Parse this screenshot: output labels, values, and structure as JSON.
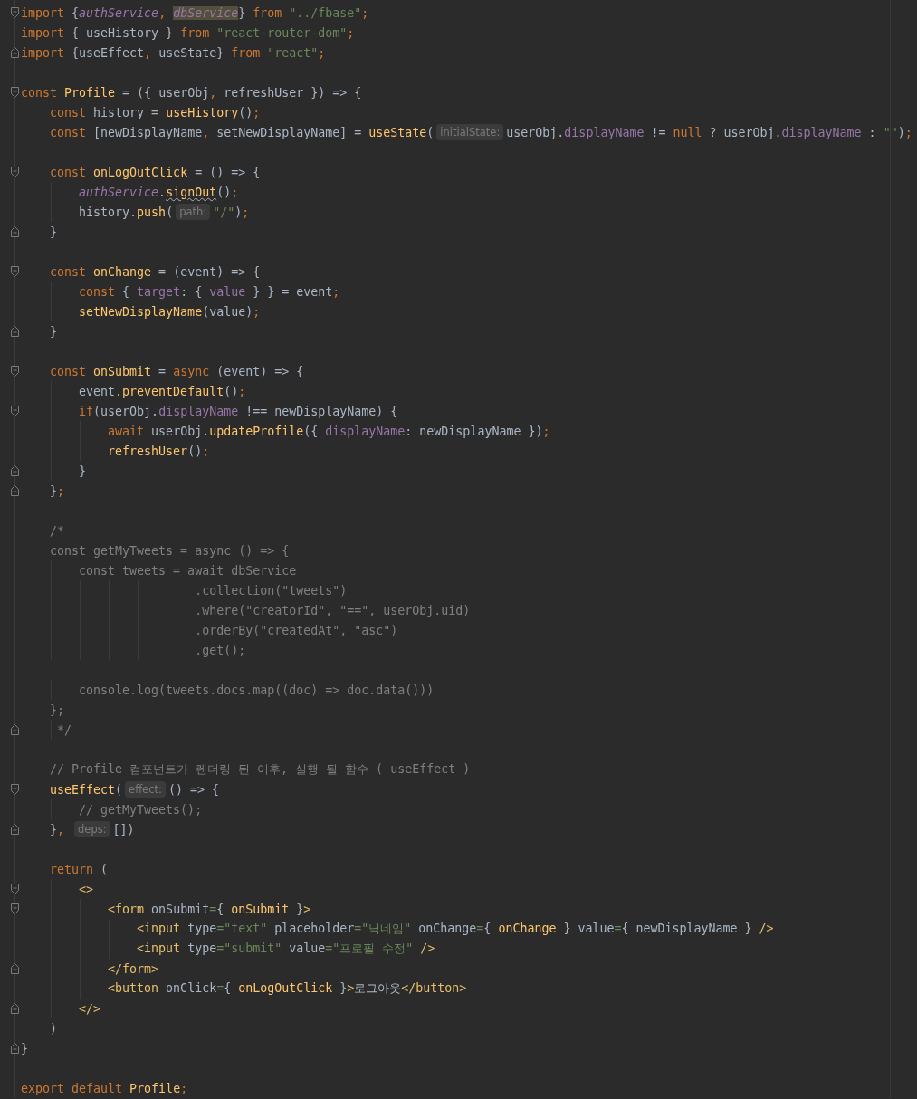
{
  "editor": {
    "lines": [
      {
        "kind": "fold-start",
        "tokens": [
          {
            "kind": "keyword",
            "text": "import "
          },
          {
            "kind": "plain",
            "text": "{"
          },
          {
            "kind": "italic-field",
            "text": "authService"
          },
          {
            "kind": "keyword",
            "text": ", "
          },
          {
            "kind": "highlighted",
            "text": "dbService"
          },
          {
            "kind": "plain",
            "text": "} "
          },
          {
            "kind": "keyword",
            "text": "from "
          },
          {
            "kind": "string",
            "text": "\"../fbase\""
          },
          {
            "kind": "keyword",
            "text": ";"
          }
        ]
      },
      {
        "kind": "code",
        "tokens": [
          {
            "kind": "keyword",
            "text": "import "
          },
          {
            "kind": "plain",
            "text": "{ useHistory } "
          },
          {
            "kind": "keyword",
            "text": "from "
          },
          {
            "kind": "string",
            "text": "\"react-router-dom\""
          },
          {
            "kind": "keyword",
            "text": ";"
          }
        ]
      },
      {
        "kind": "fold-end",
        "tokens": [
          {
            "kind": "keyword",
            "text": "import "
          },
          {
            "kind": "plain",
            "text": "{useEffect"
          },
          {
            "kind": "keyword",
            "text": ", "
          },
          {
            "kind": "plain",
            "text": "useState} "
          },
          {
            "kind": "keyword",
            "text": "from "
          },
          {
            "kind": "string",
            "text": "\"react\""
          },
          {
            "kind": "keyword",
            "text": ";"
          }
        ]
      },
      {
        "kind": "blank"
      },
      {
        "kind": "fold-start",
        "tokens": [
          {
            "kind": "keyword",
            "text": "const "
          },
          {
            "kind": "function",
            "text": "Profile"
          },
          {
            "kind": "plain",
            "text": " = ({ userObj"
          },
          {
            "kind": "keyword",
            "text": ", "
          },
          {
            "kind": "plain",
            "text": "refreshUser }) => {"
          }
        ]
      },
      {
        "kind": "code",
        "tokens": [
          {
            "kind": "keyword",
            "text": "    const "
          },
          {
            "kind": "plain",
            "text": "history = "
          },
          {
            "kind": "function",
            "text": "useHistory"
          },
          {
            "kind": "plain",
            "text": "()"
          },
          {
            "kind": "keyword",
            "text": ";"
          }
        ]
      },
      {
        "kind": "code",
        "tokens": [
          {
            "kind": "keyword",
            "text": "    const "
          },
          {
            "kind": "plain",
            "text": "[newDisplayName"
          },
          {
            "kind": "keyword",
            "text": ", "
          },
          {
            "kind": "plain",
            "text": "setNewDisplayName] = "
          },
          {
            "kind": "function",
            "text": "useState"
          },
          {
            "kind": "plain",
            "text": "("
          },
          {
            "kind": "hint",
            "text": "initialState:"
          },
          {
            "kind": "plain",
            "text": "userObj."
          },
          {
            "kind": "field",
            "text": "displayName"
          },
          {
            "kind": "plain",
            "text": " != "
          },
          {
            "kind": "keyword",
            "text": "null "
          },
          {
            "kind": "plain",
            "text": "? userObj."
          },
          {
            "kind": "field",
            "text": "displayName"
          },
          {
            "kind": "plain",
            "text": " : "
          },
          {
            "kind": "string",
            "text": "\"\""
          },
          {
            "kind": "plain",
            "text": ")"
          },
          {
            "kind": "keyword",
            "text": ";"
          }
        ]
      },
      {
        "kind": "blank"
      },
      {
        "kind": "fold-start",
        "tokens": [
          {
            "kind": "keyword",
            "text": "    const "
          },
          {
            "kind": "function",
            "text": "onLogOutClick"
          },
          {
            "kind": "plain",
            "text": " = () => {"
          }
        ]
      },
      {
        "kind": "code",
        "tokens": [
          {
            "kind": "italic-field",
            "text": "        authService"
          },
          {
            "kind": "plain",
            "text": "."
          },
          {
            "kind": "warning",
            "text": "signOut"
          },
          {
            "kind": "plain",
            "text": "()"
          },
          {
            "kind": "keyword",
            "text": ";"
          }
        ]
      },
      {
        "kind": "code",
        "tokens": [
          {
            "kind": "plain",
            "text": "        history."
          },
          {
            "kind": "function",
            "text": "push"
          },
          {
            "kind": "plain",
            "text": "("
          },
          {
            "kind": "hint",
            "text": "path:"
          },
          {
            "kind": "string",
            "text": "\"/\""
          },
          {
            "kind": "plain",
            "text": ")"
          },
          {
            "kind": "keyword",
            "text": ";"
          }
        ]
      },
      {
        "kind": "fold-end",
        "tokens": [
          {
            "kind": "plain",
            "text": "    }"
          }
        ]
      },
      {
        "kind": "blank"
      },
      {
        "kind": "fold-start",
        "tokens": [
          {
            "kind": "keyword",
            "text": "    const "
          },
          {
            "kind": "function",
            "text": "onChange"
          },
          {
            "kind": "plain",
            "text": " = (event) => {"
          }
        ]
      },
      {
        "kind": "code",
        "tokens": [
          {
            "kind": "keyword",
            "text": "        const "
          },
          {
            "kind": "plain",
            "text": "{ "
          },
          {
            "kind": "field",
            "text": "target"
          },
          {
            "kind": "plain",
            "text": ": { "
          },
          {
            "kind": "field",
            "text": "value"
          },
          {
            "kind": "plain",
            "text": " } } = event"
          },
          {
            "kind": "keyword",
            "text": ";"
          }
        ]
      },
      {
        "kind": "code",
        "tokens": [
          {
            "kind": "function",
            "text": "        setNewDisplayName"
          },
          {
            "kind": "plain",
            "text": "(value)"
          },
          {
            "kind": "keyword",
            "text": ";"
          }
        ]
      },
      {
        "kind": "fold-end",
        "tokens": [
          {
            "kind": "plain",
            "text": "    }"
          }
        ]
      },
      {
        "kind": "blank"
      },
      {
        "kind": "fold-start",
        "tokens": [
          {
            "kind": "keyword",
            "text": "    const "
          },
          {
            "kind": "function",
            "text": "onSubmit"
          },
          {
            "kind": "plain",
            "text": " = "
          },
          {
            "kind": "keyword",
            "text": "async "
          },
          {
            "kind": "plain",
            "text": "(event) => {"
          }
        ]
      },
      {
        "kind": "code",
        "tokens": [
          {
            "kind": "plain",
            "text": "        event."
          },
          {
            "kind": "function",
            "text": "preventDefault"
          },
          {
            "kind": "plain",
            "text": "()"
          },
          {
            "kind": "keyword",
            "text": ";"
          }
        ]
      },
      {
        "kind": "fold-start",
        "tokens": [
          {
            "kind": "keyword",
            "text": "        if"
          },
          {
            "kind": "plain",
            "text": "(userObj."
          },
          {
            "kind": "field",
            "text": "displayName"
          },
          {
            "kind": "plain",
            "text": " !== newDisplayName) {"
          }
        ]
      },
      {
        "kind": "code",
        "tokens": [
          {
            "kind": "keyword",
            "text": "            await "
          },
          {
            "kind": "plain",
            "text": "userObj."
          },
          {
            "kind": "function",
            "text": "updateProfile"
          },
          {
            "kind": "plain",
            "text": "({ "
          },
          {
            "kind": "field",
            "text": "displayName"
          },
          {
            "kind": "plain",
            "text": ": newDisplayName })"
          },
          {
            "kind": "keyword",
            "text": ";"
          }
        ]
      },
      {
        "kind": "code",
        "tokens": [
          {
            "kind": "function",
            "text": "            refreshUser"
          },
          {
            "kind": "plain",
            "text": "()"
          },
          {
            "kind": "keyword",
            "text": ";"
          }
        ]
      },
      {
        "kind": "fold-end",
        "tokens": [
          {
            "kind": "plain",
            "text": "        }"
          }
        ]
      },
      {
        "kind": "fold-end",
        "tokens": [
          {
            "kind": "plain",
            "text": "    }"
          },
          {
            "kind": "keyword",
            "text": ";"
          }
        ]
      },
      {
        "kind": "blank"
      },
      {
        "kind": "code",
        "tokens": [
          {
            "kind": "comment",
            "text": "    /*"
          }
        ]
      },
      {
        "kind": "code",
        "tokens": [
          {
            "kind": "comment",
            "text": "    const getMyTweets = async () => {"
          }
        ]
      },
      {
        "kind": "code",
        "tokens": [
          {
            "kind": "comment",
            "text": "        const tweets = await dbService"
          }
        ]
      },
      {
        "kind": "code",
        "tokens": [
          {
            "kind": "comment",
            "text": "                        .collection(\"tweets\")"
          }
        ]
      },
      {
        "kind": "code",
        "tokens": [
          {
            "kind": "comment",
            "text": "                        .where(\"creatorId\", \"==\", userObj.uid)"
          }
        ]
      },
      {
        "kind": "code",
        "tokens": [
          {
            "kind": "comment",
            "text": "                        .orderBy(\"createdAt\", \"asc\")"
          }
        ]
      },
      {
        "kind": "code",
        "tokens": [
          {
            "kind": "comment",
            "text": "                        .get();"
          }
        ]
      },
      {
        "kind": "blank"
      },
      {
        "kind": "code",
        "tokens": [
          {
            "kind": "comment",
            "text": "        console.log(tweets.docs.map((doc) => doc.data()))"
          }
        ]
      },
      {
        "kind": "code",
        "tokens": [
          {
            "kind": "comment",
            "text": "    };"
          }
        ]
      },
      {
        "kind": "fold-end",
        "tokens": [
          {
            "kind": "comment",
            "text": "     */"
          }
        ]
      },
      {
        "kind": "blank"
      },
      {
        "kind": "code",
        "tokens": [
          {
            "kind": "comment",
            "text": "    // Profile 컴포넌트가 렌더링 된 이후, 실행 될 함수 ( useEffect )"
          }
        ]
      },
      {
        "kind": "fold-start",
        "tokens": [
          {
            "kind": "function",
            "text": "    useEffect"
          },
          {
            "kind": "plain",
            "text": "("
          },
          {
            "kind": "hint",
            "text": "effect:"
          },
          {
            "kind": "plain",
            "text": "() => {"
          }
        ]
      },
      {
        "kind": "code",
        "tokens": [
          {
            "kind": "comment",
            "text": "        // getMyTweets();"
          }
        ]
      },
      {
        "kind": "fold-end",
        "tokens": [
          {
            "kind": "plain",
            "text": "    }"
          },
          {
            "kind": "keyword",
            "text": ", "
          },
          {
            "kind": "hint",
            "text": "deps:"
          },
          {
            "kind": "plain",
            "text": "[])"
          }
        ]
      },
      {
        "kind": "blank"
      },
      {
        "kind": "code",
        "tokens": [
          {
            "kind": "keyword",
            "text": "    return "
          },
          {
            "kind": "plain",
            "text": "("
          }
        ]
      },
      {
        "kind": "fold-start",
        "tokens": [
          {
            "kind": "tag",
            "text": "        <>"
          }
        ]
      },
      {
        "kind": "fold-start",
        "tokens": [
          {
            "kind": "tag",
            "text": "            <form "
          },
          {
            "kind": "plain",
            "text": "onSubmit"
          },
          {
            "kind": "string",
            "text": "="
          },
          {
            "kind": "plain",
            "text": "{ "
          },
          {
            "kind": "function",
            "text": "onSubmit"
          },
          {
            "kind": "plain",
            "text": " }"
          },
          {
            "kind": "tag",
            "text": ">"
          }
        ]
      },
      {
        "kind": "code",
        "tokens": [
          {
            "kind": "tag",
            "text": "                <input "
          },
          {
            "kind": "plain",
            "text": "type"
          },
          {
            "kind": "string",
            "text": "=\"text\" "
          },
          {
            "kind": "plain",
            "text": "placeholder"
          },
          {
            "kind": "string",
            "text": "=\"닉네임\" "
          },
          {
            "kind": "plain",
            "text": "onChange"
          },
          {
            "kind": "string",
            "text": "="
          },
          {
            "kind": "plain",
            "text": "{ "
          },
          {
            "kind": "function",
            "text": "onChange"
          },
          {
            "kind": "plain",
            "text": " } value"
          },
          {
            "kind": "string",
            "text": "="
          },
          {
            "kind": "plain",
            "text": "{ newDisplayName } "
          },
          {
            "kind": "tag",
            "text": "/>"
          }
        ]
      },
      {
        "kind": "code",
        "tokens": [
          {
            "kind": "tag",
            "text": "                <input "
          },
          {
            "kind": "plain",
            "text": "type"
          },
          {
            "kind": "string",
            "text": "=\"submit\" "
          },
          {
            "kind": "plain",
            "text": "value"
          },
          {
            "kind": "string",
            "text": "=\"프로필 수정\" "
          },
          {
            "kind": "tag",
            "text": "/>"
          }
        ]
      },
      {
        "kind": "fold-end",
        "tokens": [
          {
            "kind": "tag",
            "text": "            </form>"
          }
        ]
      },
      {
        "kind": "code",
        "tokens": [
          {
            "kind": "tag",
            "text": "            <button "
          },
          {
            "kind": "plain",
            "text": "onClick"
          },
          {
            "kind": "string",
            "text": "="
          },
          {
            "kind": "plain",
            "text": "{ "
          },
          {
            "kind": "function",
            "text": "onLogOutClick"
          },
          {
            "kind": "plain",
            "text": " }"
          },
          {
            "kind": "tag",
            "text": ">"
          },
          {
            "kind": "plain",
            "text": "로그아웃"
          },
          {
            "kind": "tag",
            "text": "</button>"
          }
        ]
      },
      {
        "kind": "fold-end",
        "tokens": [
          {
            "kind": "tag",
            "text": "        </>"
          }
        ]
      },
      {
        "kind": "code",
        "tokens": [
          {
            "kind": "plain",
            "text": "    )"
          }
        ]
      },
      {
        "kind": "fold-end",
        "tokens": [
          {
            "kind": "plain",
            "text": "}"
          }
        ]
      },
      {
        "kind": "blank"
      },
      {
        "kind": "code",
        "tokens": [
          {
            "kind": "keyword",
            "text": "export default "
          },
          {
            "kind": "function",
            "text": "Profile"
          },
          {
            "kind": "keyword",
            "text": ";"
          }
        ]
      }
    ]
  }
}
